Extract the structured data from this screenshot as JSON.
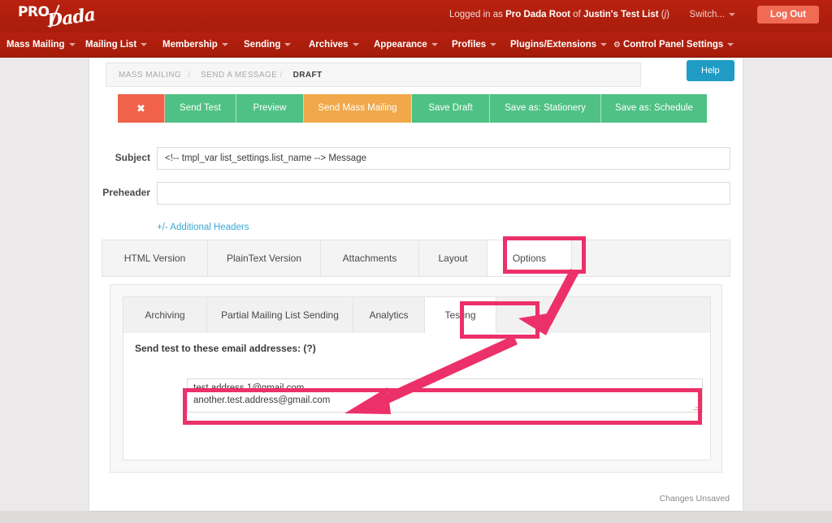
{
  "topbar": {
    "logo_pro": "PRO",
    "logo_dada": "Dada",
    "logged_in_prefix": "Logged in as ",
    "logged_in_user": "Pro Dada Root",
    "logged_in_mid": " of ",
    "logged_in_list": "Justin's Test List",
    "logged_in_suffix_open": " (",
    "logged_in_code": "j",
    "logged_in_suffix_close": ")",
    "switch_label": "Switch...",
    "logout_label": "Log Out"
  },
  "nav": {
    "items": [
      {
        "label": "Mass Mailing",
        "caret": true,
        "gear": false
      },
      {
        "label": "Mailing List",
        "caret": true,
        "gear": false
      },
      {
        "label": "Membership",
        "caret": true,
        "gear": false
      },
      {
        "label": "Sending",
        "caret": true,
        "gear": false
      },
      {
        "label": "Archives",
        "caret": true,
        "gear": false
      },
      {
        "label": "Appearance",
        "caret": true,
        "gear": false
      },
      {
        "label": "Profiles",
        "caret": true,
        "gear": false
      },
      {
        "label": "Plugins/Extensions",
        "caret": true,
        "gear": false
      },
      {
        "label": "Control Panel Settings",
        "caret": true,
        "gear": true
      }
    ]
  },
  "breadcrumb": {
    "items": [
      "MASS MAILING",
      "SEND A MESSAGE",
      "DRAFT"
    ],
    "separator": "/",
    "active_index": 2
  },
  "help": {
    "label": "Help"
  },
  "actions": [
    {
      "label": "✖",
      "style": "red",
      "name": "cancel-button"
    },
    {
      "label": "Send Test",
      "style": "green",
      "name": "send-test-button"
    },
    {
      "label": "Preview",
      "style": "green",
      "name": "preview-button"
    },
    {
      "label": "Send Mass Mailing",
      "style": "orange",
      "name": "send-mass-mailing-button"
    },
    {
      "label": "Save Draft",
      "style": "green",
      "name": "save-draft-button"
    },
    {
      "label": "Save as: Stationery",
      "style": "green",
      "name": "save-as-stationery-button"
    },
    {
      "label": "Save as: Schedule",
      "style": "green",
      "name": "save-as-schedule-button"
    }
  ],
  "form": {
    "subject_label": "Subject",
    "subject_value": "<!-- tmpl_var list_settings.list_name --> Message",
    "preheader_label": "Preheader",
    "preheader_value": "",
    "preheader_placeholder": "",
    "additional_headers_link": "+/- Additional Headers"
  },
  "tabs": {
    "items": [
      "HTML Version",
      "PlainText Version",
      "Attachments",
      "Layout",
      "Options"
    ],
    "selected": "Options"
  },
  "subtabs": {
    "items": [
      "Archiving",
      "Partial Mailing List Sending",
      "Analytics",
      "Testing"
    ],
    "selected": "Testing"
  },
  "testing_pane": {
    "label": "Send test to these email addresses: (?)",
    "emails_value": "test.address.1@gmail.com\nanother.test.address@gmail.com",
    "emails_placeholder": ""
  },
  "status": {
    "changes": "Changes Unsaved"
  },
  "colors": {
    "brand_red": "#b01e0c",
    "annotation_pink": "#ec3069",
    "green": "#4fc184",
    "orange": "#f0a84a",
    "red": "#f0634a",
    "help_teal": "#1f9bc6",
    "link_blue": "#3aa5d4"
  }
}
